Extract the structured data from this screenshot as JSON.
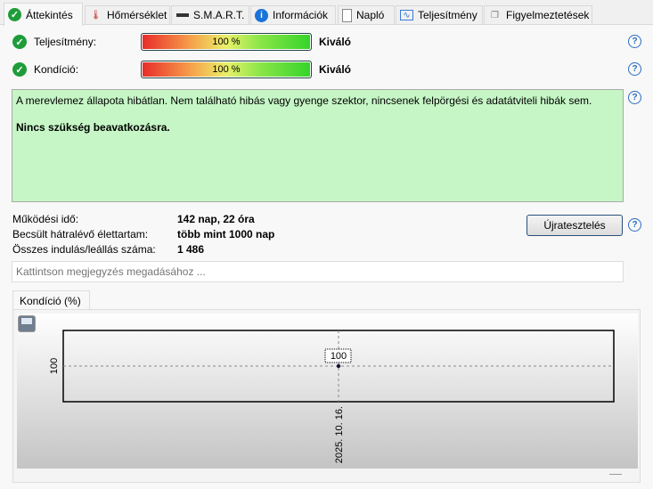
{
  "tabs": [
    {
      "label": "Áttekintés",
      "icon": "check-icon"
    },
    {
      "label": "Hőmérséklet",
      "icon": "thermometer-icon"
    },
    {
      "label": "S.M.A.R.T.",
      "icon": "drive-icon"
    },
    {
      "label": "Információk",
      "icon": "info-icon"
    },
    {
      "label": "Napló",
      "icon": "document-icon"
    },
    {
      "label": "Teljesítmény",
      "icon": "chart-icon"
    },
    {
      "label": "Figyelmeztetések",
      "icon": "copy-icon"
    }
  ],
  "metrics": [
    {
      "label": "Teljesítmény:",
      "bar": "100 %",
      "value": 100,
      "rating": "Kiváló"
    },
    {
      "label": "Kondíció:",
      "bar": "100 %",
      "value": 100,
      "rating": "Kiváló"
    }
  ],
  "status": {
    "text": "A merevlemez állapota hibátlan. Nem található hibás vagy gyenge szektor, nincsenek felpörgési és adatátviteli hibák sem.",
    "bold": "Nincs szükség beavatkozásra.",
    "color": "#c6f6c6"
  },
  "info": [
    {
      "label": "Működési idő:",
      "value": "142 nap, 22 óra"
    },
    {
      "label": "Becsült hátralévő élettartam:",
      "value": "több mint 1000 nap"
    },
    {
      "label": "Összes indulás/leállás száma:",
      "value": "1 486"
    }
  ],
  "retest": "Újratesztelés",
  "note_placeholder": "Kattintson megjegyzés megadásához ...",
  "chart_tab": "Kondíció  (%)",
  "chart_data": {
    "type": "line",
    "x": [
      "2025. 10. 16."
    ],
    "values": [
      100
    ],
    "point_labels": [
      "100"
    ],
    "ytick_labels": [
      "100"
    ],
    "xtick_labels": [
      "2025. 10. 16."
    ]
  }
}
